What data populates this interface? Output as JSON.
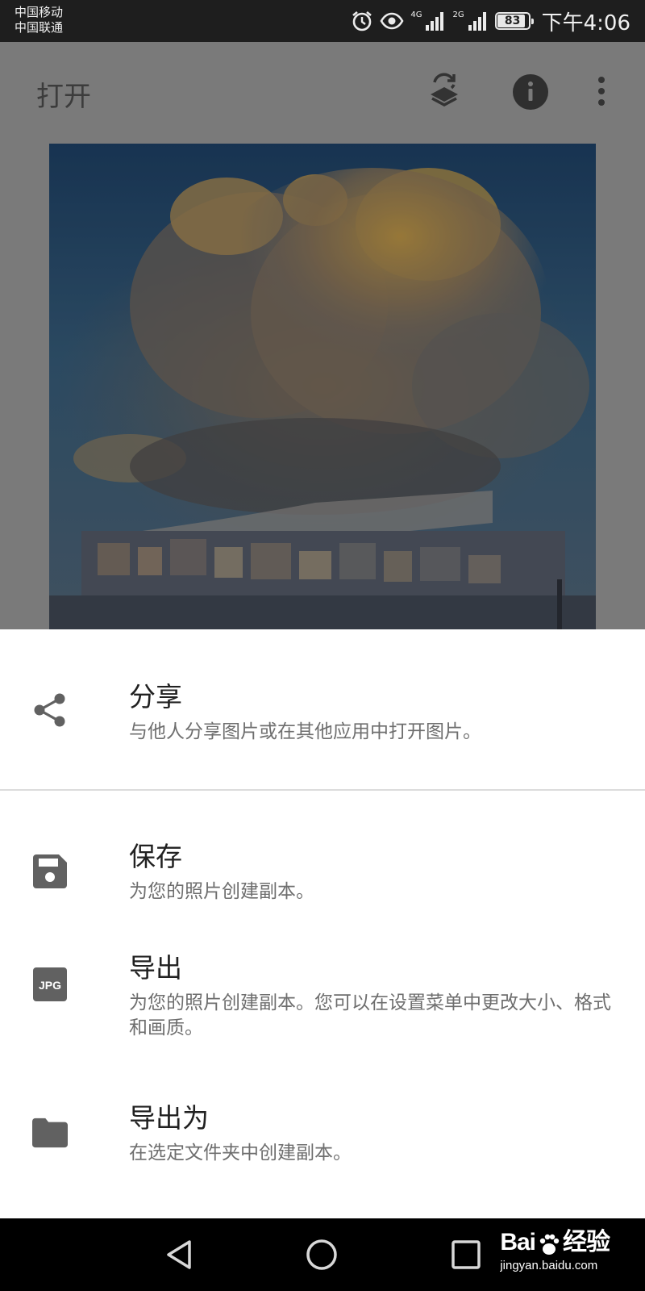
{
  "status_bar": {
    "carrier_1": "中国移动",
    "carrier_2": "中国联通",
    "net_1": "4G",
    "net_2": "2G",
    "battery": "83",
    "time": "下午4:06"
  },
  "app_bar": {
    "title": "打开",
    "icons": [
      "layers-refresh-icon",
      "info-icon",
      "more-vert-icon"
    ]
  },
  "sheet": {
    "items": [
      {
        "title": "分享",
        "description": "与他人分享图片或在其他应用中打开图片。",
        "icon": "share-icon"
      },
      {
        "title": "保存",
        "description": "为您的照片创建副本。",
        "icon": "save-icon"
      },
      {
        "title": "导出",
        "description": "为您的照片创建副本。您可以在设置菜单中更改大小、格式和画质。",
        "icon": "jpg-icon",
        "icon_text": "JPG"
      },
      {
        "title": "导出为",
        "description": "在选定文件夹中创建副本。",
        "icon": "folder-icon"
      }
    ]
  },
  "watermark": {
    "brand_a": "Bai",
    "brand_b": "经验",
    "url": "jingyan.baidu.com"
  },
  "colors": {
    "status_bar": "#1e1e1e",
    "scrim": "#7a7a7a",
    "sheet": "#ffffff",
    "icon": "#606060",
    "nav_bar": "#000000"
  }
}
